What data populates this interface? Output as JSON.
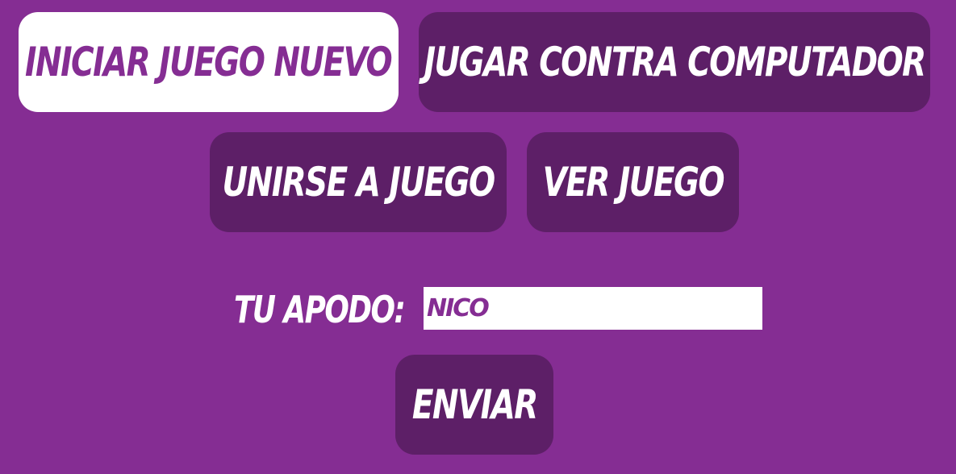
{
  "menu": {
    "new_game_label": "Iniciar Juego Nuevo",
    "vs_computer_label": "Jugar contra computador",
    "join_game_label": "Unirse a juego",
    "watch_game_label": "Ver juego"
  },
  "nickname": {
    "label": "Tu apodo:",
    "value": "Nico"
  },
  "submit": {
    "label": "Enviar"
  },
  "colors": {
    "background": "#852d93",
    "button": "#5d1f67",
    "button_active": "#ffffff",
    "text": "#ffffff",
    "accent_text": "#852d93"
  }
}
